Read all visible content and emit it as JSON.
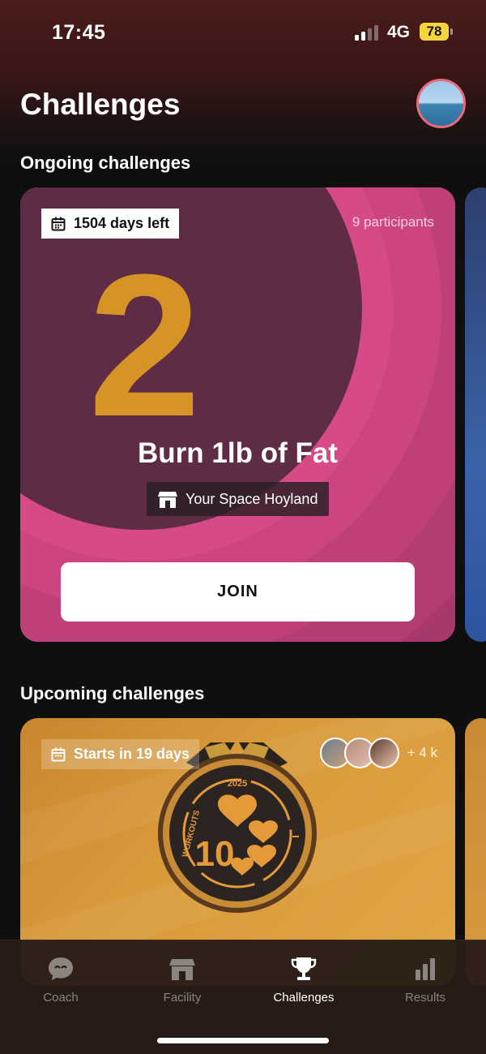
{
  "status_bar": {
    "time": "17:45",
    "network": "4G",
    "battery": "78"
  },
  "header": {
    "title": "Challenges",
    "avatar_icon": "profile-avatar"
  },
  "sections": {
    "ongoing": "Ongoing challenges",
    "upcoming": "Upcoming challenges"
  },
  "ongoing_card": {
    "days_left": "1504 days left",
    "participants": "9 participants",
    "number": "2",
    "title": "Burn 1lb of Fat",
    "venue": "Your Space Hoyland",
    "join_label": "JOIN",
    "colors": {
      "base": "#a33a6a",
      "accent": "#d69427"
    }
  },
  "upcoming_card": {
    "starts": "Starts in 19 days",
    "more_participants": "+ 4 k",
    "medal": {
      "year": "2025",
      "number": "10",
      "side_text": "WORKOUTS"
    }
  },
  "tab_bar": {
    "tabs": [
      {
        "label": "Coach",
        "icon": "chat-bubble-icon",
        "active": false
      },
      {
        "label": "Facility",
        "icon": "storefront-icon",
        "active": false
      },
      {
        "label": "Challenges",
        "icon": "trophy-icon",
        "active": true
      },
      {
        "label": "Results",
        "icon": "bar-chart-icon",
        "active": false
      }
    ]
  }
}
